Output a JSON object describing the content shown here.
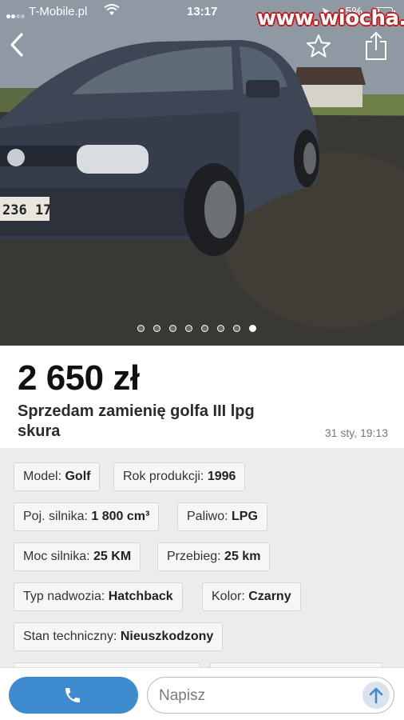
{
  "status_bar": {
    "carrier": "T-Mobile.pl",
    "time": "13:17",
    "battery": "35%"
  },
  "watermark": "www.wiocha.pl",
  "icons": {
    "back": "chevron-left-icon",
    "favorite": "star-icon",
    "share": "share-icon",
    "call": "phone-icon",
    "send": "arrow-up-icon"
  },
  "gallery": {
    "photo_count": 8,
    "active_index": 7,
    "plate_text": "236 17"
  },
  "listing": {
    "price": "2 650 zł",
    "title": "Sprzedam zamienię golfa III lpg skura",
    "date": "31 sty, 19:13"
  },
  "params": [
    {
      "label": "Model:",
      "value": "Golf"
    },
    {
      "label": "Rok produkcji:",
      "value": "1996"
    },
    {
      "label": "Poj. silnika:",
      "value": "1 800 cm³"
    },
    {
      "label": "Paliwo:",
      "value": "LPG"
    },
    {
      "label": "Moc silnika:",
      "value": "25 KM"
    },
    {
      "label": "Przebieg:",
      "value": "25 km"
    },
    {
      "label": "Typ nadwozia:",
      "value": "Hatchback"
    },
    {
      "label": "Kolor:",
      "value": "Czarny"
    },
    {
      "label": "Stan techniczny:",
      "value": "Nieuszkodzony"
    }
  ],
  "message": {
    "placeholder": "Napisz",
    "value": ""
  },
  "colors": {
    "accent": "#3f8bd0",
    "send_bg": "#d8e3ee",
    "watermark_outline": "#c21d1d"
  }
}
